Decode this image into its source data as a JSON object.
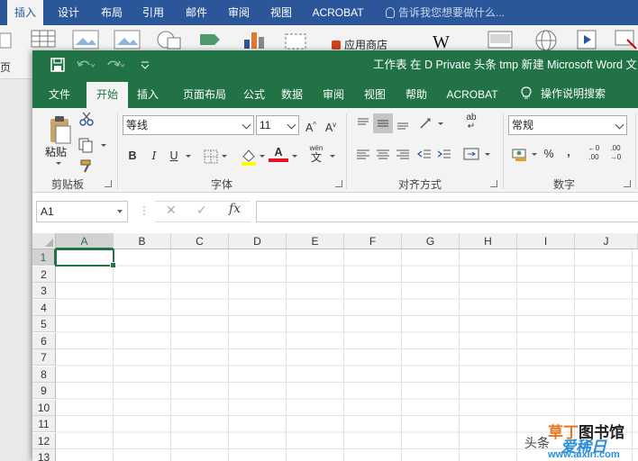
{
  "word": {
    "tabs": [
      {
        "label": "插入",
        "active": true
      },
      {
        "label": "设计"
      },
      {
        "label": "布局"
      },
      {
        "label": "引用"
      },
      {
        "label": "邮件"
      },
      {
        "label": "审阅"
      },
      {
        "label": "视图"
      },
      {
        "label": "ACROBAT"
      }
    ],
    "tell_me": "告诉我您想要做什么...",
    "page_label": "页",
    "store_label": "应用商店",
    "wiki_label": "W"
  },
  "excel": {
    "title": "工作表 在 D  Private 头条 tmp 新建 Microsoft Word 文",
    "tabs": [
      {
        "label": "文件"
      },
      {
        "label": "开始",
        "active": true
      },
      {
        "label": "插入"
      },
      {
        "label": "页面布局"
      },
      {
        "label": "公式"
      },
      {
        "label": "数据"
      },
      {
        "label": "审阅"
      },
      {
        "label": "视图"
      },
      {
        "label": "帮助"
      },
      {
        "label": "ACROBAT"
      }
    ],
    "tell_me": "操作说明搜索",
    "ribbon": {
      "clipboard": {
        "paste_label": "粘贴",
        "group_label": "剪贴板"
      },
      "font": {
        "font_name": "等线",
        "font_size": "11",
        "grow_label": "A",
        "shrink_label": "A",
        "bold": "B",
        "italic": "I",
        "underline": "U",
        "font_color_label": "A",
        "phonetic_top": "wén",
        "phonetic_char": "文",
        "group_label": "字体"
      },
      "alignment": {
        "wrap_label": "ab",
        "group_label": "对齐方式"
      },
      "number": {
        "format": "常规",
        "percent": "%",
        "comma": ",",
        "inc_decimal": "←0 .00",
        "dec_decimal": ".00 →0",
        "group_label": "数字"
      }
    },
    "formula_bar": {
      "name_box": "A1",
      "fx": "fx",
      "formula": ""
    },
    "columns": [
      "A",
      "B",
      "C",
      "D",
      "E",
      "F",
      "G",
      "H",
      "I",
      "J"
    ],
    "rows": [
      "1",
      "2",
      "3",
      "4",
      "5",
      "6",
      "7",
      "8",
      "9",
      "10",
      "11",
      "12",
      "13"
    ],
    "active_cell": "A1"
  },
  "watermark": {
    "headline": "头条",
    "logo_orange": "草丁",
    "logo_dark": "图书馆",
    "brand": "爱稀日",
    "url": "www.aixiri.com"
  },
  "colors": {
    "excel_green": "#217346",
    "word_blue": "#2b579a"
  }
}
